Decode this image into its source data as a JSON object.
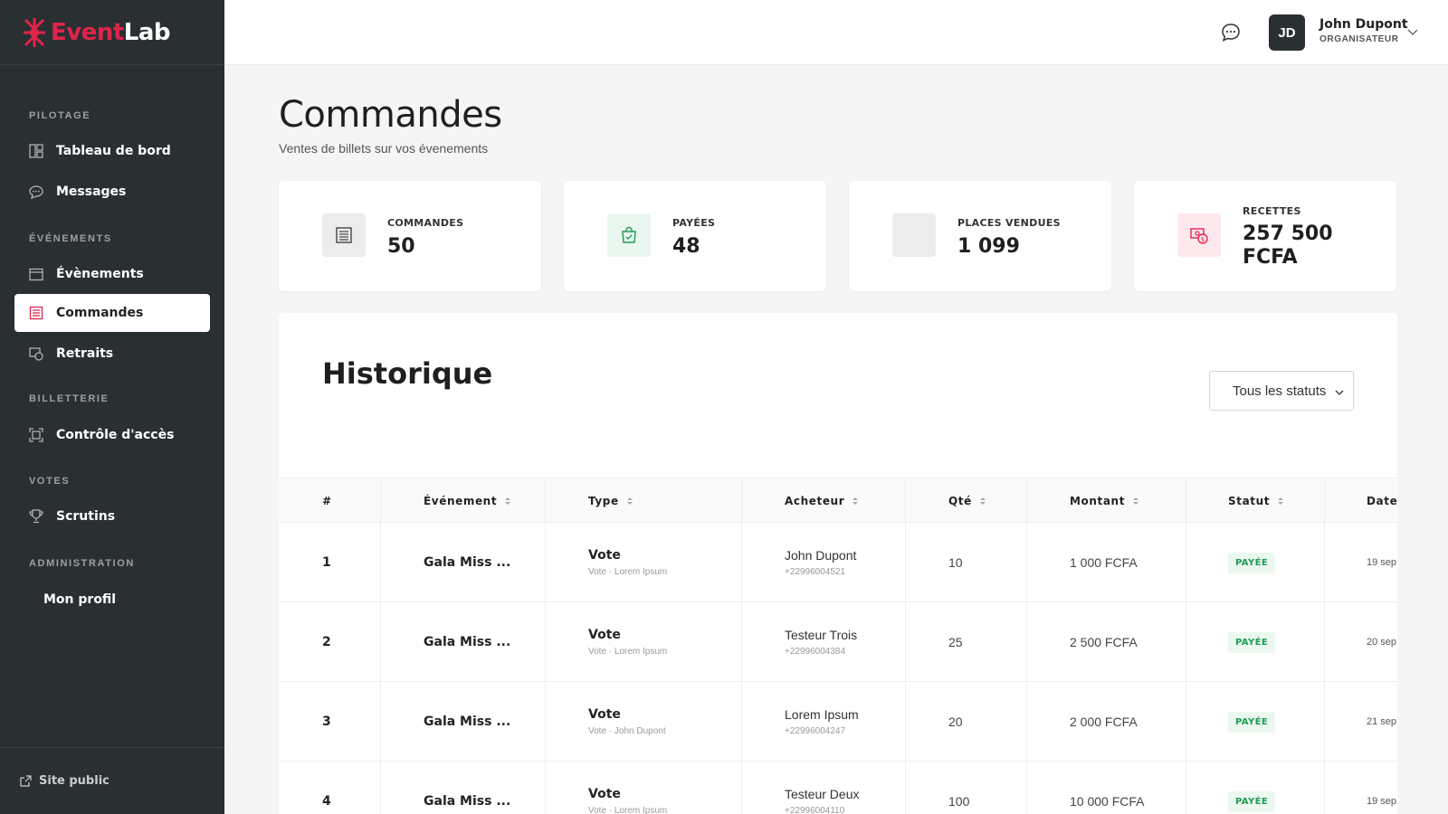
{
  "brand": {
    "name_part1": "Event",
    "name_part2": "Lab",
    "accent_color": "#e0244a"
  },
  "sidebar": {
    "sections": [
      {
        "label": "PILOTAGE"
      },
      {
        "label": "ÉVÉNEMENTS"
      },
      {
        "label": "BILLETTERIE"
      },
      {
        "label": "VOTES"
      },
      {
        "label": "ADMINISTRATION"
      }
    ],
    "items": [
      {
        "label": "Tableau de bord",
        "icon": "dashboard-icon"
      },
      {
        "label": "Messages",
        "icon": "chat-icon"
      },
      {
        "label": "Évènements",
        "icon": "calendar-icon"
      },
      {
        "label": "Commandes",
        "icon": "orders-icon",
        "active": true
      },
      {
        "label": "Retraits",
        "icon": "withdraw-icon"
      },
      {
        "label": "Contrôle d'accès",
        "icon": "scan-icon"
      },
      {
        "label": "Scrutins",
        "icon": "trophy-icon"
      },
      {
        "label": "Mon profil",
        "icon": ""
      }
    ],
    "footer_link": "Site public"
  },
  "topbar": {
    "avatar_initials": "JD",
    "user_name": "John Dupont",
    "user_role": "ORGANISATEUR"
  },
  "page": {
    "title": "Commandes",
    "subtitle": "Ventes de billets sur vos évenements"
  },
  "stats": [
    {
      "label": "COMMANDES",
      "value": "50",
      "icon": "list-icon",
      "color": "#ececec"
    },
    {
      "label": "PAYÉES",
      "value": "48",
      "icon": "bag-check-icon",
      "color": "#e9f7f0"
    },
    {
      "label": "PLACES VENDUES",
      "value": "1 099",
      "icon": "blank-icon",
      "color": "#ececec"
    },
    {
      "label": "RECETTES",
      "value_line1": "257 500",
      "value_line2": "FCFA",
      "icon": "money-icon",
      "color": "#fde8ee"
    }
  ],
  "history": {
    "title": "Historique",
    "filter_label": "Tous les statuts",
    "columns": [
      "#",
      "Événement",
      "Type",
      "Acheteur",
      "Qté",
      "Montant",
      "Statut",
      "Date"
    ],
    "rows": [
      {
        "num": "1",
        "event": "Gala Miss ...",
        "type": "Vote",
        "type_sub": "Vote · Lorem Ipsum",
        "buyer": "John Dupont",
        "phone": "+22996004521",
        "qty": "10",
        "amount": "1 000 FCFA",
        "status": "PAYÉE",
        "date": "19 sep"
      },
      {
        "num": "2",
        "event": "Gala Miss ...",
        "type": "Vote",
        "type_sub": "Vote · Lorem Ipsum",
        "buyer": "Testeur Trois",
        "phone": "+22996004384",
        "qty": "25",
        "amount": "2 500 FCFA",
        "status": "PAYÉE",
        "date": "20 sep"
      },
      {
        "num": "3",
        "event": "Gala Miss ...",
        "type": "Vote",
        "type_sub": "Vote · John Dupont",
        "buyer": "Lorem Ipsum",
        "phone": "+22996004247",
        "qty": "20",
        "amount": "2 000 FCFA",
        "status": "PAYÉE",
        "date": "21 sep"
      },
      {
        "num": "4",
        "event": "Gala Miss ...",
        "type": "Vote",
        "type_sub": "Vote · Lorem Ipsum",
        "buyer": "Testeur Deux",
        "phone": "+22996004110",
        "qty": "100",
        "amount": "10 000 FCFA",
        "status": "PAYÉE",
        "date": "19 sep"
      }
    ]
  }
}
